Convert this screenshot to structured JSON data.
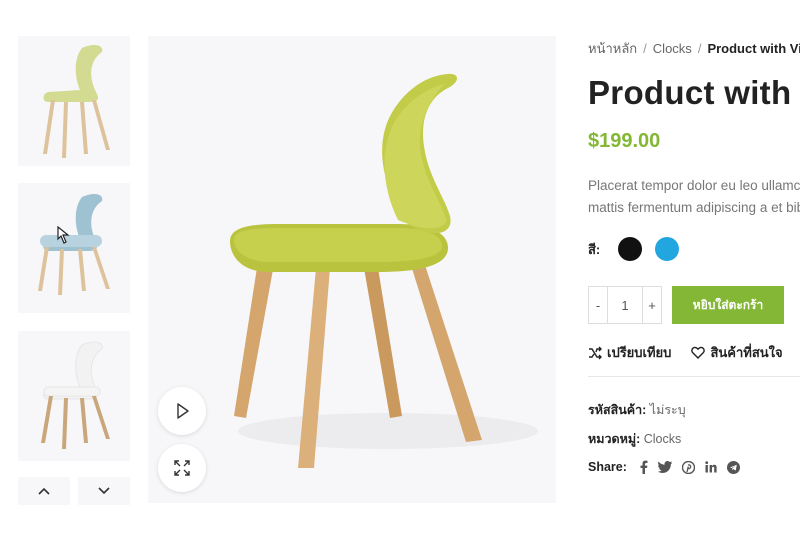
{
  "thumbnails": [
    {
      "alt": "chair-lime",
      "seat_color": "#d3db93"
    },
    {
      "alt": "chair-blue",
      "seat_color": "#9ec2d2"
    },
    {
      "alt": "chair-white",
      "seat_color": "#f2f2f2"
    }
  ],
  "main_image": {
    "seat_color": "#c2cc48",
    "leg_color": "#d4a66d"
  },
  "breadcrumb": {
    "home": "หน้าหลัก",
    "category": "Clocks",
    "current": "Product with Video"
  },
  "product": {
    "title": "Product with Video",
    "price": "$199.00",
    "description_line1": "Placerat tempor dolor eu leo ullamcorper et",
    "description_line2": "mattis fermentum adipiscing a et bibendum"
  },
  "color_label": "สี:",
  "swatches": [
    {
      "name": "black",
      "color": "#111111"
    },
    {
      "name": "blue",
      "color": "#22a6e0"
    }
  ],
  "quantity": {
    "minus": "-",
    "value": "1",
    "plus": "+"
  },
  "add_to_cart_label": "หยิบใส่ตะกร้า",
  "compare_label": "เปรียบเทียบ",
  "wishlist_label": "สินค้าที่สนใจ",
  "sku": {
    "label": "รหัสสินค้า:",
    "value": "ไม่ระบุ"
  },
  "category": {
    "label": "หมวดหมู่:",
    "value": "Clocks"
  },
  "share_label": "Share:",
  "share_icons": [
    "facebook-icon",
    "twitter-icon",
    "pinterest-icon",
    "linkedin-icon",
    "telegram-icon"
  ],
  "accent_color": "#83b735"
}
